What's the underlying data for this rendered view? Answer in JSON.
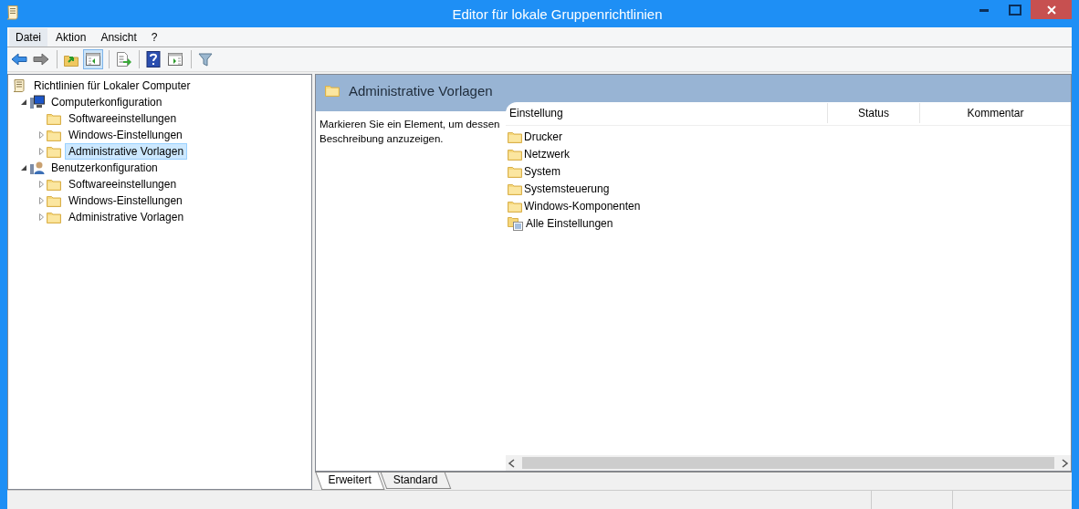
{
  "window": {
    "title": "Editor für lokale Gruppenrichtlinien"
  },
  "menu": [
    {
      "label": "Datei",
      "selected": true
    },
    {
      "label": "Aktion",
      "selected": false
    },
    {
      "label": "Ansicht",
      "selected": false
    },
    {
      "label": "?",
      "selected": false
    }
  ],
  "toolbar": [
    {
      "kind": "back",
      "pressed": false
    },
    {
      "kind": "forward",
      "pressed": false
    },
    {
      "kind": "sep"
    },
    {
      "kind": "up",
      "pressed": false
    },
    {
      "kind": "tree",
      "pressed": true
    },
    {
      "kind": "sep"
    },
    {
      "kind": "export",
      "pressed": false
    },
    {
      "kind": "sep"
    },
    {
      "kind": "help",
      "pressed": false
    },
    {
      "kind": "pane",
      "pressed": false
    },
    {
      "kind": "sep"
    },
    {
      "kind": "filter",
      "pressed": false
    }
  ],
  "tree": [
    {
      "label": "Richtlinien für Lokaler Computer",
      "kind": "policy",
      "selected": false,
      "children": [
        {
          "label": "Computerkonfiguration",
          "kind": "computer",
          "expandable": true,
          "expanded": true,
          "selected": false,
          "children": [
            {
              "label": "Softwareeinstellungen",
              "kind": "folder",
              "expandable": false,
              "selected": false
            },
            {
              "label": "Windows-Einstellungen",
              "kind": "folder",
              "expandable": true,
              "selected": false
            },
            {
              "label": "Administrative Vorlagen",
              "kind": "folder",
              "expandable": true,
              "selected": true
            }
          ]
        },
        {
          "label": "Benutzerkonfiguration",
          "kind": "user",
          "expandable": true,
          "expanded": true,
          "selected": false,
          "children": [
            {
              "label": "Softwareeinstellungen",
              "kind": "folder",
              "expandable": true,
              "selected": false
            },
            {
              "label": "Windows-Einstellungen",
              "kind": "folder",
              "expandable": true,
              "selected": false
            },
            {
              "label": "Administrative Vorlagen",
              "kind": "folder",
              "expandable": true,
              "selected": false
            }
          ]
        }
      ]
    }
  ],
  "details": {
    "title": "Administrative Vorlagen",
    "description": "Markieren Sie ein Element, um dessen Beschreibung anzuzeigen.",
    "columns": [
      "Einstellung",
      "Status",
      "Kommentar"
    ],
    "rows": [
      {
        "label": "Drucker",
        "kind": "folder"
      },
      {
        "label": "Netzwerk",
        "kind": "folder"
      },
      {
        "label": "System",
        "kind": "folder"
      },
      {
        "label": "Systemsteuerung",
        "kind": "folder"
      },
      {
        "label": "Windows-Komponenten",
        "kind": "folder"
      },
      {
        "label": "Alle Einstellungen",
        "kind": "all"
      }
    ]
  },
  "tabs": [
    {
      "label": "Erweitert",
      "selected": true
    },
    {
      "label": "Standard",
      "selected": false
    }
  ]
}
